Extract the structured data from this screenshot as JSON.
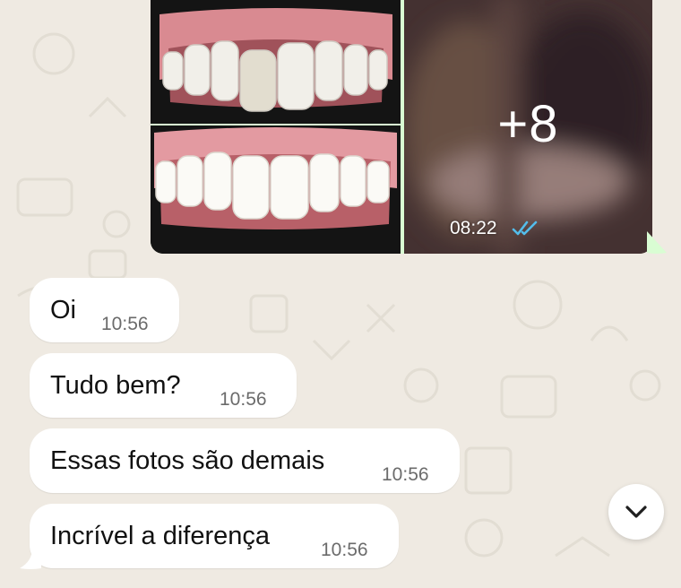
{
  "colors": {
    "chat_background": "#efeae2",
    "outgoing_bubble": "#d9fdd3",
    "incoming_bubble": "#ffffff",
    "read_ticks": "#53bdeb",
    "timestamp": "#6b6b6b"
  },
  "outgoing_media": {
    "timestamp": "08:22",
    "status_icon": "double-check-read-icon",
    "more_count": "+8"
  },
  "messages": [
    {
      "text": "Oi",
      "time": "10:56"
    },
    {
      "text": "Tudo bem?",
      "time": "10:56"
    },
    {
      "text": "Essas fotos são demais",
      "time": "10:56"
    },
    {
      "text": "Incrível a diferença",
      "time": "10:56"
    }
  ],
  "scroll_button_icon": "chevron-down-icon"
}
